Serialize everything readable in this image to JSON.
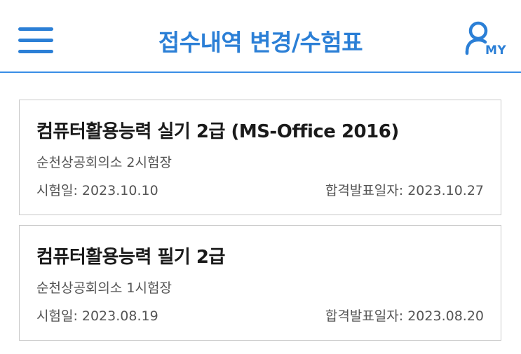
{
  "header": {
    "title": "접수내역 변경/수험표",
    "menu_icon": "hamburger-menu-icon",
    "my_icon": "user-icon",
    "my_label": "MY",
    "accent_color": "#2b7fd6"
  },
  "exams": [
    {
      "title": "컴퓨터활용능력 실기 2급 (MS-Office 2016)",
      "location": "순천상공회의소 2시험장",
      "exam_date": "시험일: 2023.10.10",
      "result_date": "합격발표일자: 2023.10.27"
    },
    {
      "title": "컴퓨터활용능력 필기 2급",
      "location": "순천상공회의소 1시험장",
      "exam_date": "시험일: 2023.08.19",
      "result_date": "합격발표일자: 2023.08.20"
    }
  ]
}
